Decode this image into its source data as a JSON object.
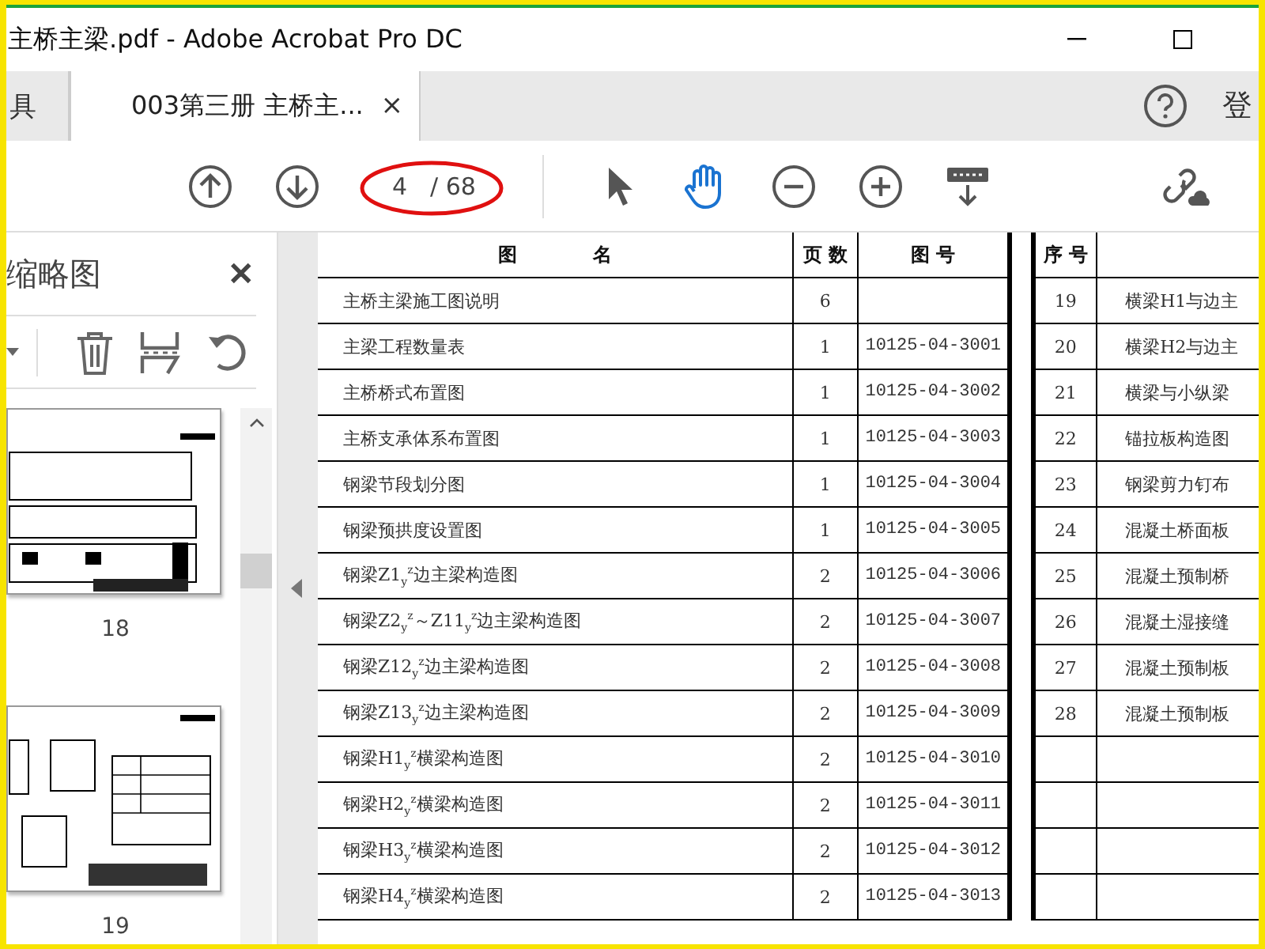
{
  "window": {
    "title": "主桥主梁.pdf - Adobe Acrobat Pro DC"
  },
  "tabs": [
    {
      "label": "具",
      "selected": false
    },
    {
      "label": "003第三册 主桥主...",
      "selected": true,
      "close": "×"
    }
  ],
  "sign_in": "登",
  "toolbar": {
    "page": "4",
    "page_total": "/ 68",
    "tools": [
      {
        "kind": "prev"
      },
      {
        "kind": "next"
      },
      {
        "kind": "pager"
      },
      {
        "kind": "select",
        "selected": false
      },
      {
        "kind": "hand",
        "selected": true
      },
      {
        "kind": "zoom-out"
      },
      {
        "kind": "zoom-in"
      },
      {
        "kind": "scroll"
      }
    ]
  },
  "sidebar": {
    "title": "缩略图",
    "close": "✕",
    "pages": [
      {
        "label": "18",
        "kind": "elevation"
      },
      {
        "label": "19",
        "kind": "section"
      }
    ]
  },
  "table": {
    "columns": [
      "图　　　　名",
      "页 数",
      "图 号"
    ],
    "rows": [
      {
        "name": "主桥主梁施工图说明",
        "pages": "6",
        "number": ""
      },
      {
        "name": "主梁工程数量表",
        "pages": "1",
        "number": "10125-04-3001"
      },
      {
        "name": "主桥桥式布置图",
        "pages": "1",
        "number": "10125-04-3002"
      },
      {
        "name": "主桥支承体系布置图",
        "pages": "1",
        "number": "10125-04-3003"
      },
      {
        "name": "钢梁节段划分图",
        "pages": "1",
        "number": "10125-04-3004"
      },
      {
        "name": "钢梁预拱度设置图",
        "pages": "1",
        "number": "10125-04-3005"
      },
      {
        "name": "钢梁Z1$_{y}$$^{z}$边主梁构造图",
        "pages": "2",
        "number": "10125-04-3006"
      },
      {
        "name": "钢梁Z2$_{y}$$^{z}$～Z11$_{y}$$^{z}$边主梁构造图",
        "pages": "2",
        "number": "10125-04-3007"
      },
      {
        "name": "钢梁Z12$_{y}$$^{z}$边主梁构造图",
        "pages": "2",
        "number": "10125-04-3008"
      },
      {
        "name": "钢梁Z13$_{y}$$^{z}$边主梁构造图",
        "pages": "2",
        "number": "10125-04-3009"
      },
      {
        "name": "钢梁H1$_{y}$$^{z}$横梁构造图",
        "pages": "2",
        "number": "10125-04-3010"
      },
      {
        "name": "钢梁H2$_{y}$$^{z}$横梁构造图",
        "pages": "2",
        "number": "10125-04-3011"
      },
      {
        "name": "钢梁H3$_{y}$$^{z}$横梁构造图",
        "pages": "2",
        "number": "10125-04-3012"
      },
      {
        "name": "钢梁H4$_{y}$$^{z}$横梁构造图",
        "pages": "2",
        "number": "10125-04-3013"
      }
    ],
    "right_columns": [
      "序 号"
    ],
    "right_rows": [
      {
        "seq": "19",
        "name": "横梁H1与边主"
      },
      {
        "seq": "20",
        "name": "横梁H2与边主"
      },
      {
        "seq": "21",
        "name": "横梁与小纵梁"
      },
      {
        "seq": "22",
        "name": "锚拉板构造图"
      },
      {
        "seq": "23",
        "name": "钢梁剪力钉布"
      },
      {
        "seq": "24",
        "name": "混凝土桥面板"
      },
      {
        "seq": "25",
        "name": "混凝土预制桥"
      },
      {
        "seq": "26",
        "name": "混凝土湿接缝"
      },
      {
        "seq": "27",
        "name": "混凝土预制板"
      },
      {
        "seq": "28",
        "name": "混凝土预制板"
      }
    ]
  }
}
